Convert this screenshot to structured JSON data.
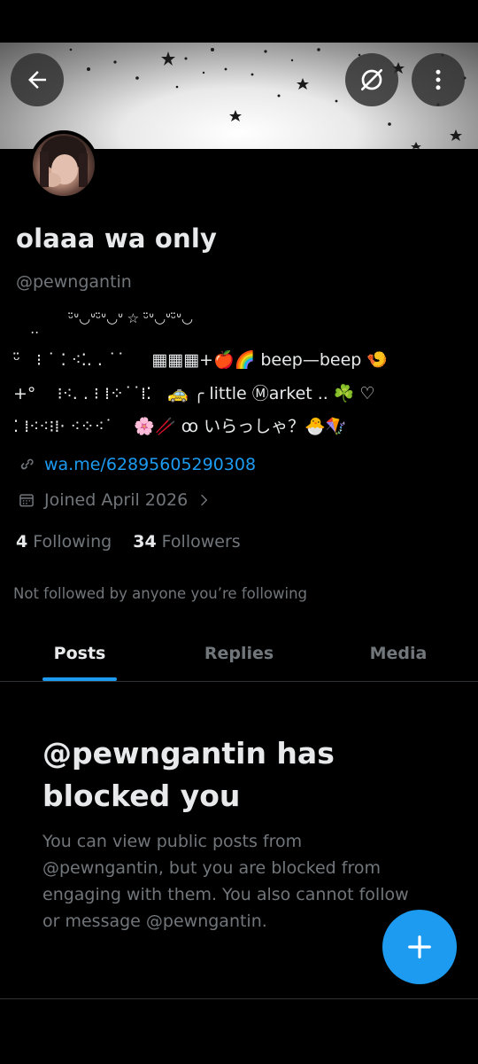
{
  "header": {
    "back_icon": "arrow-left-icon",
    "grok_icon": "grok-slash-icon",
    "more_icon": "more-vertical-icon"
  },
  "profile": {
    "display_name": "olaaa wa only",
    "handle": "@pewngantin",
    "bio_lines": [
      "             ᵕ̈ᐡ◡ᐡᵕ̈ᐡ◡ᐡ ☆ ᵕ̈ᐡ◡ᐡᵕ̈ᐡ◡",
      "    ‥",
      "ᵕ̈   ⁝ ˙ ⁚ ⁖⁚. . ˙˙     ▦▦▦+🍎🌈 beep—beep 🍤",
      "+°    ⁝⁖. . ⁝ ⁞⁘˙˙⁞⁚   🚕 ╭ little Ⓜarket .. ☘️ ♡",
      "⁚ ⁞⁖⁖⁝⁞· ⁖⁘⁖˙    🌸🥢 ꝏ いらっしゃ？🐣🪁"
    ],
    "link": "wa.me/62895605290308",
    "joined": "Joined April 2026",
    "following_count": "4",
    "following_label": "Following",
    "followers_count": "34",
    "followers_label": "Followers",
    "not_followed_text": "Not followed by anyone you’re following"
  },
  "tabs": [
    {
      "label": "Posts",
      "active": true
    },
    {
      "label": "Replies",
      "active": false
    },
    {
      "label": "Media",
      "active": false
    }
  ],
  "blocked": {
    "title": "@pewngantin has blocked you",
    "description": "You can view public posts from @pewngantin, but you are blocked from engaging with them. You also cannot follow or message @pewngantin."
  },
  "fab": {
    "icon": "plus-icon"
  },
  "colors": {
    "background": "#000000",
    "text_primary": "#e7e9ea",
    "text_secondary": "#71767b",
    "accent": "#1d9bf0",
    "divider": "#2f3336"
  }
}
